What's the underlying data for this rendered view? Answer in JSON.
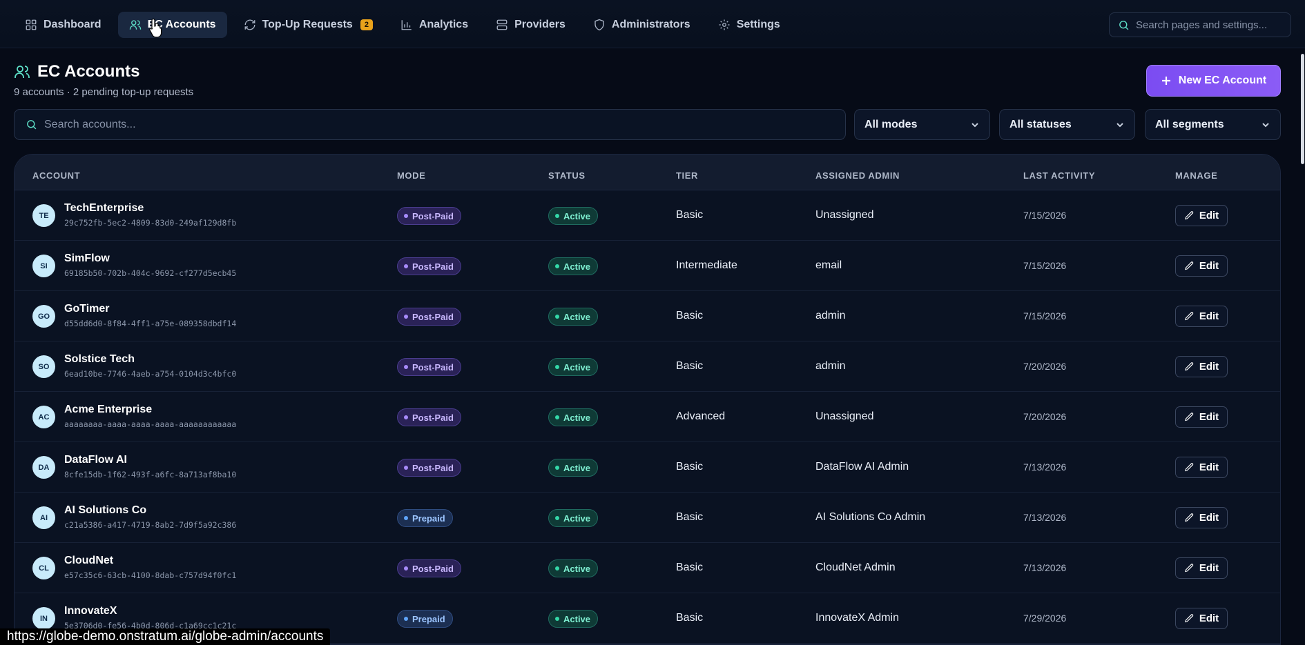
{
  "nav": {
    "items": [
      {
        "label": "Dashboard",
        "icon": "grid-icon"
      },
      {
        "label": "EC Accounts",
        "icon": "users-icon",
        "active": true
      },
      {
        "label": "Top-Up Requests",
        "icon": "refresh-icon",
        "badge": "2"
      },
      {
        "label": "Analytics",
        "icon": "bar-chart-icon"
      },
      {
        "label": "Providers",
        "icon": "server-icon"
      },
      {
        "label": "Administrators",
        "icon": "shield-icon"
      },
      {
        "label": "Settings",
        "icon": "gear-icon"
      }
    ],
    "search_placeholder": "Search pages and settings..."
  },
  "page": {
    "title": "EC Accounts",
    "subtitle": "9 accounts · 2 pending top-up requests",
    "new_button": "New EC Account"
  },
  "filters": {
    "search_placeholder": "Search accounts...",
    "mode": "All modes",
    "status": "All statuses",
    "segment": "All segments"
  },
  "table": {
    "headers": {
      "account": "ACCOUNT",
      "mode": "MODE",
      "status": "STATUS",
      "tier": "TIER",
      "admin": "ASSIGNED ADMIN",
      "activity": "LAST ACTIVITY",
      "manage": "MANAGE"
    },
    "edit_label": "Edit",
    "rows": [
      {
        "initials": "TE",
        "name": "TechEnterprise",
        "id": "29c752fb-5ec2-4809-83d0-249af129d8fb",
        "mode": "Post-Paid",
        "status": "Active",
        "tier": "Basic",
        "admin": "Unassigned",
        "activity": "7/15/2026"
      },
      {
        "initials": "SI",
        "name": "SimFlow",
        "id": "69185b50-702b-404c-9692-cf277d5ecb45",
        "mode": "Post-Paid",
        "status": "Active",
        "tier": "Intermediate",
        "admin": "email",
        "activity": "7/15/2026"
      },
      {
        "initials": "GO",
        "name": "GoTimer",
        "id": "d55dd6d0-8f84-4ff1-a75e-089358dbdf14",
        "mode": "Post-Paid",
        "status": "Active",
        "tier": "Basic",
        "admin": "admin",
        "activity": "7/15/2026"
      },
      {
        "initials": "SO",
        "name": "Solstice Tech",
        "id": "6ead10be-7746-4aeb-a754-0104d3c4bfc0",
        "mode": "Post-Paid",
        "status": "Active",
        "tier": "Basic",
        "admin": "admin",
        "activity": "7/20/2026"
      },
      {
        "initials": "AC",
        "name": "Acme Enterprise",
        "id": "aaaaaaaa-aaaa-aaaa-aaaa-aaaaaaaaaaaa",
        "mode": "Post-Paid",
        "status": "Active",
        "tier": "Advanced",
        "admin": "Unassigned",
        "activity": "7/20/2026"
      },
      {
        "initials": "DA",
        "name": "DataFlow AI",
        "id": "8cfe15db-1f62-493f-a6fc-8a713af8ba10",
        "mode": "Post-Paid",
        "status": "Active",
        "tier": "Basic",
        "admin": "DataFlow AI Admin",
        "activity": "7/13/2026"
      },
      {
        "initials": "AI",
        "name": "AI Solutions Co",
        "id": "c21a5386-a417-4719-8ab2-7d9f5a92c386",
        "mode": "Prepaid",
        "status": "Active",
        "tier": "Basic",
        "admin": "AI Solutions Co Admin",
        "activity": "7/13/2026"
      },
      {
        "initials": "CL",
        "name": "CloudNet",
        "id": "e57c35c6-63cb-4100-8dab-c757d94f0fc1",
        "mode": "Post-Paid",
        "status": "Active",
        "tier": "Basic",
        "admin": "CloudNet Admin",
        "activity": "7/13/2026"
      },
      {
        "initials": "IN",
        "name": "InnovateX",
        "id": "5e3706d0-fe56-4b0d-806d-c1a69cc1c21c",
        "mode": "Prepaid",
        "status": "Active",
        "tier": "Basic",
        "admin": "InnovateX Admin",
        "activity": "7/29/2026"
      }
    ]
  },
  "status_bar": {
    "url": "https://globe-demo.onstratum.ai/globe-admin/accounts"
  },
  "colors": {
    "accent": "#8b5cf6",
    "teal": "#5ee0c8",
    "background": "#060b17"
  }
}
